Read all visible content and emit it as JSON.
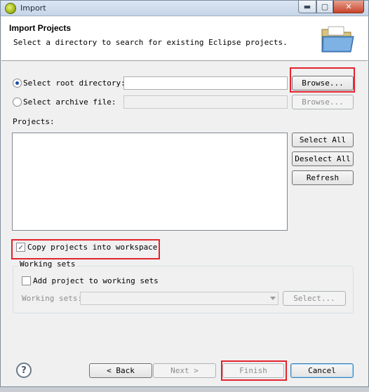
{
  "window": {
    "title": "Import",
    "min_glyph": "▬",
    "max_glyph": "▢",
    "close_glyph": "✕"
  },
  "header": {
    "title": "Import Projects",
    "description": "Select a directory to search for existing Eclipse projects."
  },
  "source": {
    "root_directory": {
      "label": "Select root directory:",
      "selected": true,
      "value": "",
      "browse_label": "Browse..."
    },
    "archive_file": {
      "label": "Select archive file:",
      "selected": false,
      "value": "",
      "browse_label": "Browse..."
    }
  },
  "projects": {
    "label": "Projects:",
    "items": [],
    "select_all_label": "Select All",
    "deselect_all_label": "Deselect All",
    "refresh_label": "Refresh"
  },
  "options": {
    "copy_into_workspace": {
      "label": "Copy projects into workspace",
      "checked": true,
      "check_glyph": "✓"
    }
  },
  "working_sets": {
    "group_title": "Working sets",
    "add_label": "Add project to working sets",
    "add_checked": false,
    "field_label": "Working sets:",
    "value": "",
    "select_label": "Select..."
  },
  "footer": {
    "help_glyph": "?",
    "back_label": "< Back",
    "next_label": "Next >",
    "finish_label": "Finish",
    "cancel_label": "Cancel"
  },
  "colors": {
    "highlight_box": "#e3232e",
    "dialog_bg": "#f0f0f0",
    "radio_dot": "#1e4fa8"
  }
}
